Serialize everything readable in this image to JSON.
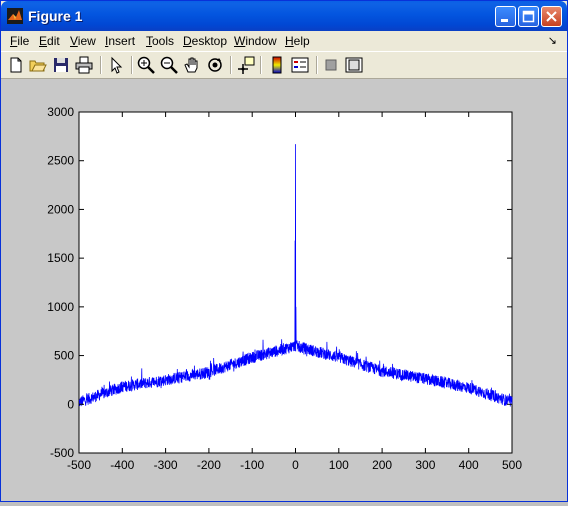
{
  "window": {
    "title": "Figure 1",
    "icon": "matlab-icon",
    "controls": [
      "minimize-icon",
      "maximize-icon",
      "close-icon"
    ]
  },
  "menu": {
    "items": [
      {
        "label": "File",
        "underline": "F",
        "rest": "ile"
      },
      {
        "label": "Edit",
        "underline": "E",
        "rest": "dit"
      },
      {
        "label": "View",
        "underline": "V",
        "rest": "iew"
      },
      {
        "label": "Insert",
        "underline": "I",
        "rest": "nsert"
      },
      {
        "label": "Tools",
        "underline": "T",
        "rest": "ools"
      },
      {
        "label": "Desktop",
        "underline": "D",
        "rest": "esktop"
      },
      {
        "label": "Window",
        "underline": "W",
        "rest": "indow"
      },
      {
        "label": "Help",
        "underline": "H",
        "rest": "elp"
      }
    ],
    "dock_glyph": "↘"
  },
  "toolbar": {
    "tools": [
      "new-figure-icon",
      "open-file-icon",
      "save-icon",
      "print-icon",
      "edit-plot-arrow-icon",
      "zoom-in-icon",
      "zoom-out-icon",
      "pan-hand-icon",
      "rotate-3d-icon",
      "data-cursor-icon",
      "colorbar-icon",
      "legend-icon",
      "hide-plot-tools-icon",
      "show-plot-tools-icon"
    ]
  },
  "chart_data": {
    "type": "line",
    "title": "",
    "xlabel": "",
    "ylabel": "",
    "xlim": [
      -500,
      500
    ],
    "ylim": [
      -500,
      3000
    ],
    "xticks": [
      -500,
      -400,
      -300,
      -200,
      -100,
      0,
      100,
      200,
      300,
      400,
      500
    ],
    "yticks": [
      -500,
      0,
      500,
      1000,
      1500,
      2000,
      2500,
      3000
    ],
    "grid": false,
    "series": [
      {
        "color": "#0000ff",
        "envelope_x": [
          -500,
          -400,
          -300,
          -200,
          -100,
          0,
          100,
          200,
          300,
          400,
          500
        ],
        "envelope_y": [
          20,
          180,
          250,
          330,
          480,
          600,
          480,
          340,
          260,
          170,
          20
        ],
        "noise_amplitude": 60,
        "spikes": [
          {
            "x": 0,
            "y": 2670
          },
          {
            "x": -1,
            "y": 1680
          },
          {
            "x": 1,
            "y": 1000
          }
        ]
      }
    ]
  }
}
